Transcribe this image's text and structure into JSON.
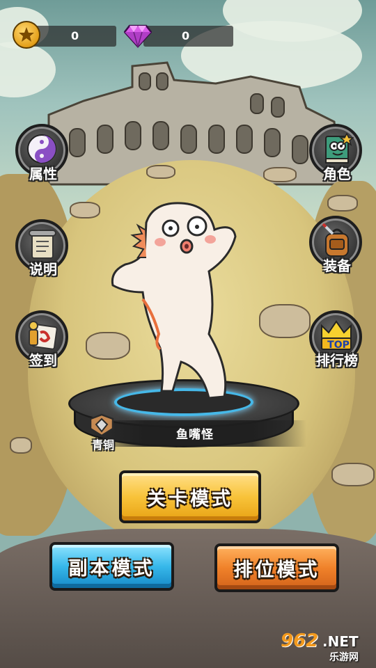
{
  "resources": {
    "coins": "0",
    "gems": "0"
  },
  "side_left": [
    {
      "label": "属性",
      "icon": "yin-yang-icon"
    },
    {
      "label": "说明",
      "icon": "scroll-icon"
    },
    {
      "label": "签到",
      "icon": "calendar-icon"
    }
  ],
  "side_right": [
    {
      "label": "角色",
      "icon": "book-icon"
    },
    {
      "label": "装备",
      "icon": "backpack-icon"
    },
    {
      "label": "排行榜",
      "icon": "crown-icon",
      "badge": "TOP"
    }
  ],
  "character": {
    "name": "鱼嘴怪",
    "rank": "青铜"
  },
  "modes": {
    "stage": "关卡模式",
    "dungeon": "副本模式",
    "ranked": "排位模式"
  },
  "watermark": {
    "brand": "962",
    "domain": ".NET",
    "caption": "乐游网"
  },
  "colors": {
    "stage_button": "#f8c33a",
    "dungeon_button": "#37b8ea",
    "ranked_button": "#f0822a",
    "portal_ring": "#46b8e8"
  }
}
